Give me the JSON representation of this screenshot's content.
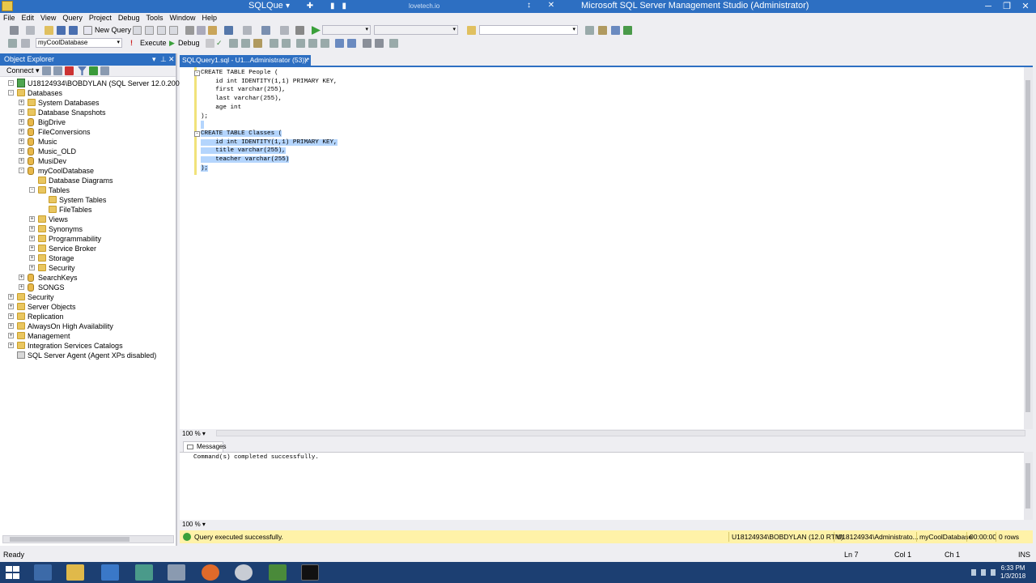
{
  "window": {
    "doc_title": "SQLQue",
    "center_text": "lovetech.io",
    "app_title": "Microsoft SQL Server Management Studio (Administrator)"
  },
  "menu": [
    "File",
    "Edit",
    "View",
    "Query",
    "Project",
    "Debug",
    "Tools",
    "Window",
    "Help"
  ],
  "toolbar": {
    "new_query": "New Query",
    "database": "myCoolDatabase",
    "execute": "Execute",
    "debug": "Debug"
  },
  "object_explorer": {
    "title": "Object Explorer",
    "connect": "Connect",
    "server": "U18124934\\BOBDYLAN (SQL Server 12.0.2000 - U1812",
    "tree": [
      {
        "label": "Databases",
        "level": 1,
        "kind": "folder",
        "expander": "-"
      },
      {
        "label": "System Databases",
        "level": 2,
        "kind": "folder",
        "expander": "+"
      },
      {
        "label": "Database Snapshots",
        "level": 2,
        "kind": "folder",
        "expander": "+"
      },
      {
        "label": "BigDrive",
        "level": 2,
        "kind": "db",
        "expander": "+"
      },
      {
        "label": "FileConversions",
        "level": 2,
        "kind": "db",
        "expander": "+"
      },
      {
        "label": "Music",
        "level": 2,
        "kind": "db",
        "expander": "+"
      },
      {
        "label": "Music_OLD",
        "level": 2,
        "kind": "db",
        "expander": "+"
      },
      {
        "label": "MusiDev",
        "level": 2,
        "kind": "db",
        "expander": "+"
      },
      {
        "label": "myCoolDatabase",
        "level": 2,
        "kind": "db",
        "expander": "-"
      },
      {
        "label": "Database Diagrams",
        "level": 3,
        "kind": "folder",
        "expander": ""
      },
      {
        "label": "Tables",
        "level": 3,
        "kind": "folder",
        "expander": "-"
      },
      {
        "label": "System Tables",
        "level": 4,
        "kind": "folder",
        "expander": ""
      },
      {
        "label": "FileTables",
        "level": 4,
        "kind": "folder",
        "expander": ""
      },
      {
        "label": "Views",
        "level": 3,
        "kind": "folder",
        "expander": "+"
      },
      {
        "label": "Synonyms",
        "level": 3,
        "kind": "folder",
        "expander": "+"
      },
      {
        "label": "Programmability",
        "level": 3,
        "kind": "folder",
        "expander": "+"
      },
      {
        "label": "Service Broker",
        "level": 3,
        "kind": "folder",
        "expander": "+"
      },
      {
        "label": "Storage",
        "level": 3,
        "kind": "folder",
        "expander": "+"
      },
      {
        "label": "Security",
        "level": 3,
        "kind": "folder",
        "expander": "+"
      },
      {
        "label": "SearchKeys",
        "level": 2,
        "kind": "db",
        "expander": "+"
      },
      {
        "label": "SONGS",
        "level": 2,
        "kind": "db",
        "expander": "+"
      },
      {
        "label": "Security",
        "level": 1,
        "kind": "folder",
        "expander": "+"
      },
      {
        "label": "Server Objects",
        "level": 1,
        "kind": "folder",
        "expander": "+"
      },
      {
        "label": "Replication",
        "level": 1,
        "kind": "folder",
        "expander": "+"
      },
      {
        "label": "AlwaysOn High Availability",
        "level": 1,
        "kind": "folder",
        "expander": "+"
      },
      {
        "label": "Management",
        "level": 1,
        "kind": "folder",
        "expander": "+"
      },
      {
        "label": "Integration Services Catalogs",
        "level": 1,
        "kind": "folder",
        "expander": "+"
      },
      {
        "label": "SQL Server Agent (Agent XPs disabled)",
        "level": 1,
        "kind": "agent",
        "expander": ""
      }
    ]
  },
  "editor": {
    "tab_title": "SQLQuery1.sql - U1...Administrator (53))*",
    "tab_close": "×",
    "lines": [
      {
        "text": "CREATE TABLE People (",
        "fold": "-",
        "selected": false
      },
      {
        "text": "    id int IDENTITY(1,1) PRIMARY KEY,",
        "fold": "",
        "selected": false
      },
      {
        "text": "    first varchar(255),",
        "fold": "",
        "selected": false
      },
      {
        "text": "    last varchar(255),",
        "fold": "",
        "selected": false
      },
      {
        "text": "    age int",
        "fold": "",
        "selected": false
      },
      {
        "text": ");",
        "fold": "",
        "selected": false
      },
      {
        "text": "",
        "fold": "",
        "selected": true
      },
      {
        "text": "CREATE TABLE Classes (",
        "fold": "-",
        "selected": true
      },
      {
        "text": "    id int IDENTITY(1,1) PRIMARY KEY,",
        "fold": "",
        "selected": true
      },
      {
        "text": "    title varchar(255),",
        "fold": "",
        "selected": true
      },
      {
        "text": "    teacher varchar(255)",
        "fold": "",
        "selected": true
      },
      {
        "text": ");",
        "fold": "",
        "selected": true
      }
    ],
    "zoom": "100 %"
  },
  "results": {
    "tab": "Messages",
    "message": "Command(s) completed successfully.",
    "zoom": "100 %"
  },
  "query_status": {
    "status": "Query executed successfully.",
    "server": "U18124934\\BOBDYLAN (12.0 RTM)",
    "user": "U18124934\\Administrato...",
    "database": "myCoolDatabase",
    "elapsed": "00:00:00",
    "rows": "0 rows"
  },
  "statusbar": {
    "ready": "Ready",
    "ln": "Ln 7",
    "col": "Col 1",
    "ch": "Ch 1",
    "ins": "INS"
  },
  "taskbar": {
    "time": "6:33 PM",
    "date": "1/3/2018"
  },
  "colors": {
    "accent": "#2d6fc2",
    "selection": "#b4d5fd",
    "status_yellow": "#fff2a8"
  }
}
